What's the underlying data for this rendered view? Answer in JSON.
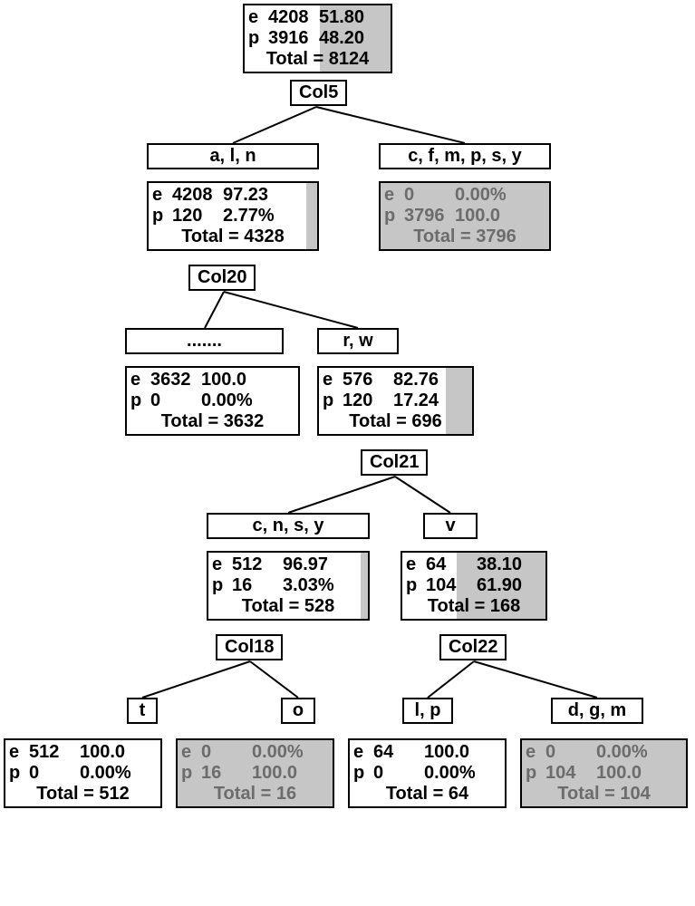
{
  "tree": {
    "root": {
      "e_count": "4208",
      "e_pct": "51.80",
      "p_count": "3916",
      "p_pct": "48.20",
      "total": "Total = 8124",
      "shade_pct": 48.2
    },
    "split1": {
      "col": "Col5"
    },
    "branch_left1": {
      "label": "a, l, n"
    },
    "branch_right1": {
      "label": "c, f, m, p, s, y"
    },
    "nodeA": {
      "e_count": "4208",
      "e_pct": "97.23",
      "p_count": "120",
      "p_pct": "2.77%",
      "total": "Total = 4328",
      "shade_pct": 3
    },
    "nodeB": {
      "e_count": "0",
      "e_pct": "0.00%",
      "p_count": "3796",
      "p_pct": "100.0",
      "total": "Total = 3796",
      "fullshade": true
    },
    "split2": {
      "col": "Col20"
    },
    "branch_left2": {
      "label": "......."
    },
    "branch_right2": {
      "label": "r, w"
    },
    "nodeC": {
      "e_count": "3632",
      "e_pct": "100.0",
      "p_count": "0",
      "p_pct": "0.00%",
      "total": "Total = 3632",
      "shade_pct": 0
    },
    "nodeD": {
      "e_count": "576",
      "e_pct": "82.76",
      "p_count": "120",
      "p_pct": "17.24",
      "total": "Total = 696",
      "shade_pct": 17
    },
    "split3": {
      "col": "Col21"
    },
    "branch_left3": {
      "label": "c, n, s, y"
    },
    "branch_right3": {
      "label": "v"
    },
    "nodeE": {
      "e_count": "512",
      "e_pct": "96.97",
      "p_count": "16",
      "p_pct": "3.03%",
      "total": "Total = 528",
      "shade_pct": 3
    },
    "nodeF": {
      "e_count": "64",
      "e_pct": "38.10",
      "p_count": "104",
      "p_pct": "61.90",
      "total": "Total = 168",
      "shade_pct": 62
    },
    "split4": {
      "col": "Col18"
    },
    "split5": {
      "col": "Col22"
    },
    "branch_t": {
      "label": "t"
    },
    "branch_o": {
      "label": "o"
    },
    "branch_lp": {
      "label": "l, p"
    },
    "branch_dgm": {
      "label": "d, g, m"
    },
    "leaf1": {
      "e_count": "512",
      "e_pct": "100.0",
      "p_count": "0",
      "p_pct": "0.00%",
      "total": "Total = 512",
      "shade_pct": 0
    },
    "leaf2": {
      "e_count": "0",
      "e_pct": "0.00%",
      "p_count": "16",
      "p_pct": "100.0",
      "total": "Total = 16",
      "fullshade": true
    },
    "leaf3": {
      "e_count": "64",
      "e_pct": "100.0",
      "p_count": "0",
      "p_pct": "0.00%",
      "total": "Total = 64",
      "shade_pct": 0
    },
    "leaf4": {
      "e_count": "0",
      "e_pct": "0.00%",
      "p_count": "104",
      "p_pct": "100.0",
      "total": "Total = 104",
      "fullshade": true
    }
  }
}
